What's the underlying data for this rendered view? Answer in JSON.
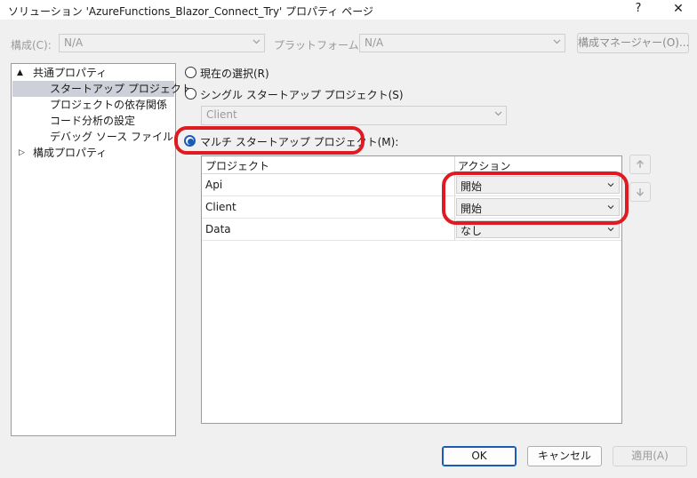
{
  "window": {
    "title": "ソリューション 'AzureFunctions_Blazor_Connect_Try' プロパティ ページ",
    "help_label": "?",
    "close_label": "✕"
  },
  "toolbar": {
    "config_label": "構成(C):",
    "config_value": "N/A",
    "platform_label": "プラットフォーム(P):",
    "platform_value": "N/A",
    "config_manager_label": "構成マネージャー(O)..."
  },
  "tree": {
    "items": [
      {
        "label": "共通プロパティ",
        "expander": "▲"
      },
      {
        "label": "スタートアップ プロジェクト"
      },
      {
        "label": "プロジェクトの依存関係"
      },
      {
        "label": "コード分析の設定"
      },
      {
        "label": "デバッグ ソース ファイル"
      },
      {
        "label": "構成プロパティ",
        "expander": "▷"
      }
    ]
  },
  "options": {
    "current_selection": "現在の選択(R)",
    "single_startup": "シングル スタートアップ プロジェクト(S)",
    "single_project_value": "Client",
    "multi_startup": "マルチ スタートアップ プロジェクト(M):"
  },
  "grid": {
    "columns": [
      "プロジェクト",
      "アクション"
    ],
    "rows": [
      {
        "project": "Api",
        "action": "開始"
      },
      {
        "project": "Client",
        "action": "開始"
      },
      {
        "project": "Data",
        "action": "なし"
      }
    ]
  },
  "buttons": {
    "ok": "OK",
    "cancel": "キャンセル",
    "apply": "適用(A)"
  },
  "colors": {
    "highlight": "#e01a22",
    "accent": "#1a5bb8"
  }
}
